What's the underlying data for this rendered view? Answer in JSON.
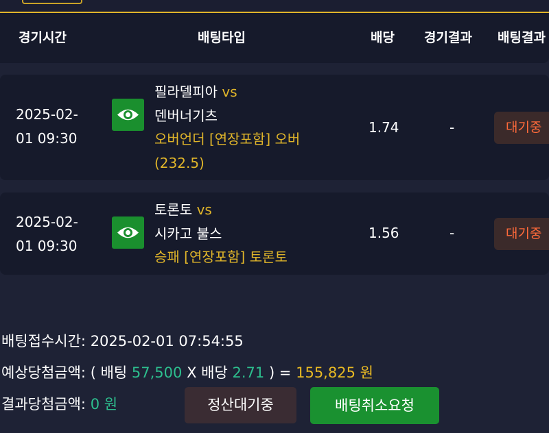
{
  "header": {
    "time": "경기시간",
    "type": "배팅타입",
    "odds": "배당",
    "result": "경기결과",
    "status": "배팅결과"
  },
  "rows": [
    {
      "date": "2025-02-",
      "clock": "01 09:30",
      "home": "필라델피아",
      "vs": "vs",
      "away": "덴버너기츠",
      "market_line1": "오버언더 [연장포함] 오버",
      "market_line2": "(232.5)",
      "odds": "1.74",
      "result": "-",
      "status": "대기중"
    },
    {
      "date": "2025-02-",
      "clock": "01 09:30",
      "home": "토론토",
      "vs": "vs",
      "away": "시카고 불스",
      "market_line1": "승패 [연장포함] 토론토",
      "odds": "1.56",
      "result": "-",
      "status": "대기중"
    }
  ],
  "summary": {
    "received_label": "배팅접수시간:",
    "received_value": "2025-02-01 07:54:55",
    "expected_label": "예상당첨금액:",
    "open_paren": "(",
    "bet_label": "배팅",
    "bet_amount": "57,500",
    "times": "X",
    "odds_label": "배당",
    "total_odds": "2.71",
    "close_eq": ") =",
    "expected_amount": "155,825",
    "won": "원",
    "result_label": "결과당첨금액:",
    "result_amount": "0",
    "result_won": "원"
  },
  "buttons": {
    "pending": "정산대기중",
    "cancel": "배팅취소요청"
  },
  "colors": {
    "accent_gold": "#e0b52a",
    "green_value": "#2dbf8e",
    "status_orange": "#ff6a3a",
    "button_green": "#1a9130"
  }
}
